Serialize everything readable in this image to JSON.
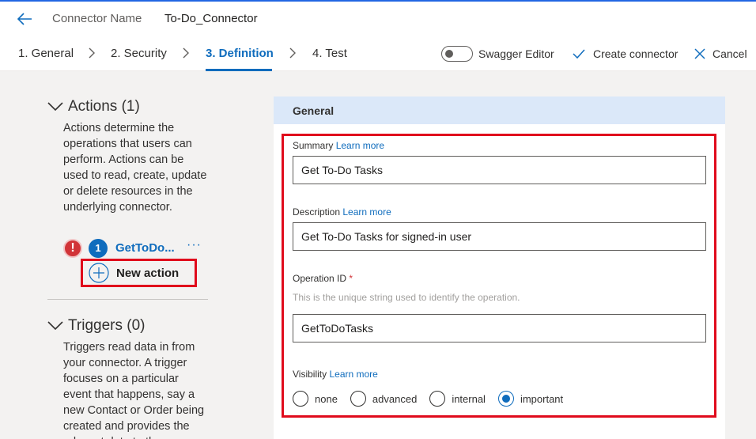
{
  "header": {
    "connector_label": "Connector Name",
    "connector_name": "To-Do_Connector"
  },
  "steps": [
    {
      "label": "1. General"
    },
    {
      "label": "2. Security"
    },
    {
      "label": "3. Definition",
      "active": true
    },
    {
      "label": "4. Test"
    }
  ],
  "toolbar": {
    "swagger_label": "Swagger Editor",
    "swagger_on": false,
    "create_label": "Create connector",
    "cancel_label": "Cancel"
  },
  "actions": {
    "heading": "Actions (1)",
    "description": "Actions determine the operations that users can perform. Actions can be used to read, create, update or delete resources in the underlying connector.",
    "error_glyph": "!",
    "item_number": "1",
    "item_name": "GetToDo...",
    "more_glyph": "···",
    "new_action_label": "New action"
  },
  "triggers": {
    "heading": "Triggers (0)",
    "description": "Triggers read data in from your connector. A trigger focuses on a particular event that happens, say a new Contact or Order being created and provides the relevant data to the"
  },
  "general": {
    "title": "General",
    "summary_label": "Summary",
    "summary_value": "Get To-Do Tasks",
    "description_label": "Description",
    "description_value": "Get To-Do Tasks for signed-in user",
    "operation_id_label": "Operation ID",
    "required_mark": "*",
    "operation_id_hint": "This is the unique string used to identify the operation.",
    "operation_id_value": "GetToDoTasks",
    "visibility_label": "Visibility",
    "learn_more": "Learn more",
    "visibility_options": [
      {
        "label": "none",
        "checked": false
      },
      {
        "label": "advanced",
        "checked": false
      },
      {
        "label": "internal",
        "checked": false
      },
      {
        "label": "important",
        "checked": true
      }
    ]
  },
  "colors": {
    "accent": "#0f6cbd",
    "highlight": "#e00b1c",
    "error": "#d13438",
    "panel_header": "#dbe8f9"
  },
  "icons": [
    "back-arrow-icon",
    "chevron-right-icon",
    "toggle-icon",
    "checkmark-icon",
    "close-icon",
    "chevron-down-icon",
    "error-icon",
    "plus-circle-icon",
    "more-icon"
  ]
}
